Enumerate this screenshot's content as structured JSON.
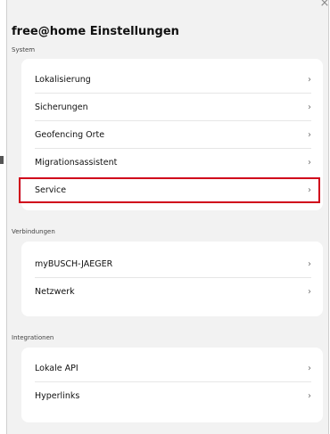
{
  "window": {
    "close_glyph": "×"
  },
  "header": {
    "title": "free@home Einstellungen"
  },
  "sections": [
    {
      "label": "System",
      "items": [
        {
          "label": "Lokalisierung"
        },
        {
          "label": "Sicherungen"
        },
        {
          "label": "Geofencing Orte"
        },
        {
          "label": "Migrationsassistent"
        },
        {
          "label": "Service",
          "highlighted": true
        }
      ]
    },
    {
      "label": "Verbindungen",
      "items": [
        {
          "label": "myBUSCH-JAEGER"
        },
        {
          "label": "Netzwerk"
        }
      ]
    },
    {
      "label": "Integrationen",
      "items": [
        {
          "label": "Lokale API"
        },
        {
          "label": "Hyperlinks"
        }
      ]
    }
  ],
  "chevron_glyph": "›",
  "colors": {
    "panel_background": "#f2f2f2",
    "card_background": "#ffffff",
    "highlight_border": "#d0021b"
  }
}
